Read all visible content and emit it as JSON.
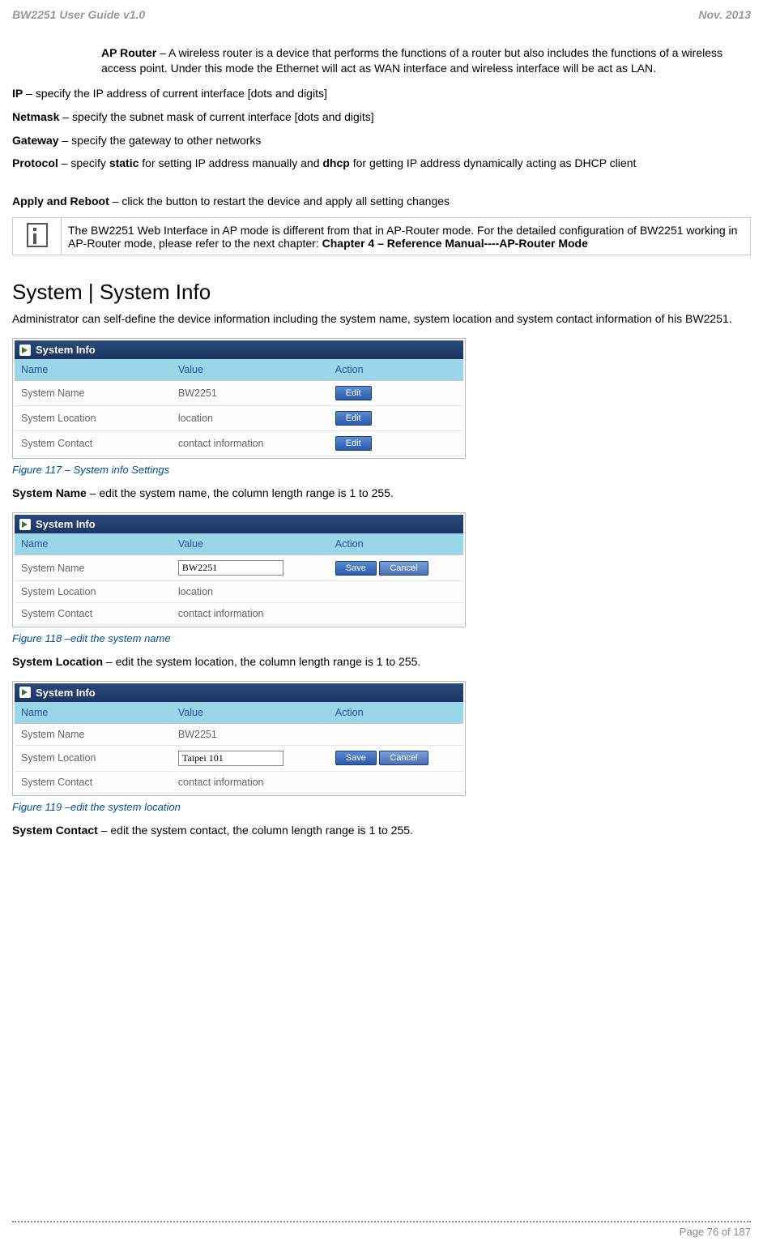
{
  "header": {
    "left": "BW2251 User Guide v1.0",
    "right": "Nov.  2013"
  },
  "content": {
    "ap_router_label": "AP Router",
    "ap_router_text": " – A wireless router is a device that performs the functions of a router but also includes the functions of a wireless access point. Under this mode the Ethernet will act as WAN interface and wireless interface will be act as LAN.",
    "ip_label": "IP",
    "ip_text": " – specify the IP address of current interface [dots and digits]",
    "netmask_label": "Netmask",
    "netmask_text": " – specify the subnet mask of current interface [dots and digits]",
    "gateway_label": "Gateway",
    "gateway_text": " – specify the gateway to other networks",
    "protocol_label": "Protocol",
    "protocol_text_1": " – specify ",
    "protocol_static": "static",
    "protocol_text_2": " for setting IP address manually and ",
    "protocol_dhcp": "dhcp",
    "protocol_text_3": " for getting IP address dynamically acting as DHCP client",
    "apply_label": "Apply and Reboot",
    "apply_text": " – click the button to restart the device and apply all setting changes",
    "note_text_1": "The BW2251 Web Interface in AP mode is different from that in AP-Router mode. For the detailed configuration of BW2251 working in AP-Router mode, please refer to the next chapter: ",
    "note_bold": "Chapter 4 – Reference Manual----AP-Router Mode",
    "section_heading": "System | System Info",
    "section_intro": "Administrator can self-define the device information including the system name, system location and system contact information of his BW2251.",
    "fig117": "Figure 117 – System info Settings",
    "sysname_label": "System Name",
    "sysname_text": " – edit the system name, the column length range is 1 to 255.",
    "fig118": "Figure 118 –edit the system name",
    "sysloc_label": "System Location",
    "sysloc_text": " – edit the system location, the column length range is 1 to 255.",
    "fig119": "Figure 119 –edit the system location",
    "syscontact_label": "System Contact",
    "syscontact_text": " – edit the system contact, the column length range is 1 to 255."
  },
  "screenshots": {
    "panel_title": "System Info",
    "col_name": "Name",
    "col_value": "Value",
    "col_action": "Action",
    "row_name": "System Name",
    "row_location": "System Location",
    "row_contact": "System Contact",
    "val_bw2251": "BW2251",
    "val_location": "location",
    "val_contact": "contact information",
    "input_bw2251": "BW2251",
    "input_taipei": "Taipei 101",
    "btn_edit": "Edit",
    "btn_save": "Save",
    "btn_cancel": "Cancel"
  },
  "footer": {
    "page": "Page 76 of 187"
  }
}
